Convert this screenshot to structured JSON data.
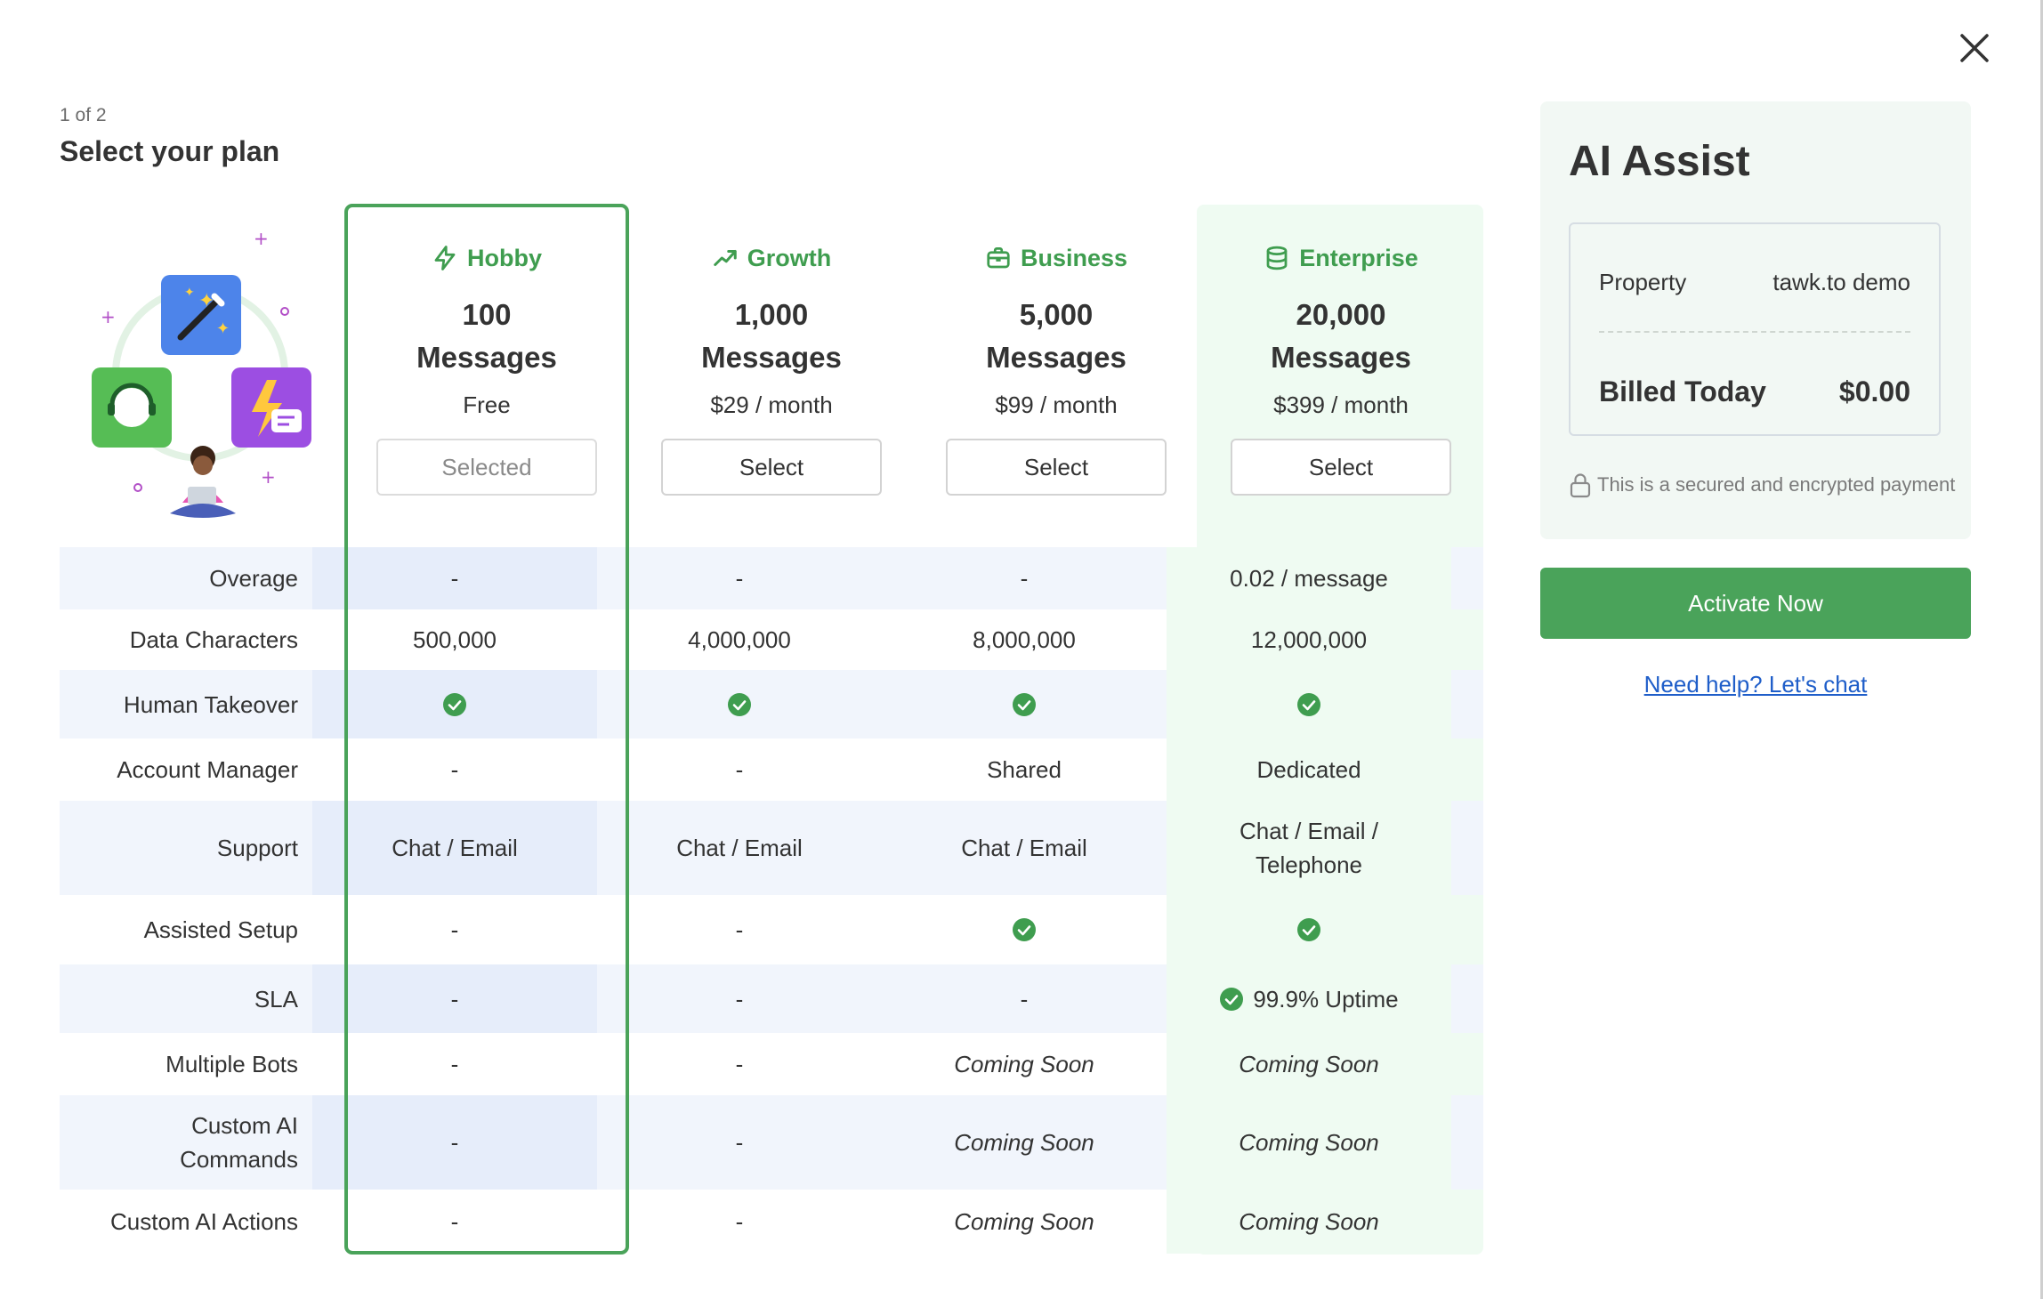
{
  "header": {
    "step": "1 of 2",
    "title": "Select your plan"
  },
  "colors": {
    "accent_green": "#4aa35a",
    "enterprise_bg": "#effbf2",
    "row_shade": "#f1f5fc",
    "link_blue": "#1f5ec9"
  },
  "plans": [
    {
      "name": "Hobby",
      "icon": "bolt-icon",
      "qty": "100",
      "unit": "Messages",
      "price": "Free",
      "button": "Selected",
      "selected": true
    },
    {
      "name": "Growth",
      "icon": "trending-up-icon",
      "qty": "1,000",
      "unit": "Messages",
      "price": "$29 / month",
      "button": "Select",
      "selected": false
    },
    {
      "name": "Business",
      "icon": "briefcase-icon",
      "qty": "5,000",
      "unit": "Messages",
      "price": "$99 / month",
      "button": "Select",
      "selected": false
    },
    {
      "name": "Enterprise",
      "icon": "database-icon",
      "qty": "20,000",
      "unit": "Messages",
      "price": "$399 / month",
      "button": "Select",
      "selected": false
    }
  ],
  "features": [
    {
      "label": "Overage",
      "values": [
        "-",
        "-",
        "-",
        "0.02 / message"
      ]
    },
    {
      "label": "Data Characters",
      "values": [
        "500,000",
        "4,000,000",
        "8,000,000",
        "12,000,000"
      ]
    },
    {
      "label": "Human Takeover",
      "values": [
        "check",
        "check",
        "check",
        "check"
      ]
    },
    {
      "label": "Account Manager",
      "values": [
        "-",
        "-",
        "Shared",
        "Dedicated"
      ]
    },
    {
      "label": "Support",
      "values": [
        "Chat / Email",
        "Chat / Email",
        "Chat / Email",
        "Chat / Email / Telephone"
      ]
    },
    {
      "label": "Assisted Setup",
      "values": [
        "-",
        "-",
        "check",
        "check"
      ]
    },
    {
      "label": "SLA",
      "values": [
        "-",
        "-",
        "-",
        "check 99.9% Uptime"
      ]
    },
    {
      "label": "Multiple Bots",
      "values": [
        "-",
        "-",
        "Coming Soon",
        "Coming Soon"
      ]
    },
    {
      "label": "Custom AI Commands",
      "values": [
        "-",
        "-",
        "Coming Soon",
        "Coming Soon"
      ]
    },
    {
      "label": "Custom AI Actions",
      "values": [
        "-",
        "-",
        "Coming Soon",
        "Coming Soon"
      ]
    }
  ],
  "summary": {
    "title": "AI Assist",
    "property_label": "Property",
    "property_value": "tawk.to demo",
    "billed_label": "Billed Today",
    "billed_value": "$0.00",
    "secure_text": "This is a secured and encrypted payment"
  },
  "actions": {
    "activate": "Activate Now",
    "help": "Need help? Let's chat"
  }
}
